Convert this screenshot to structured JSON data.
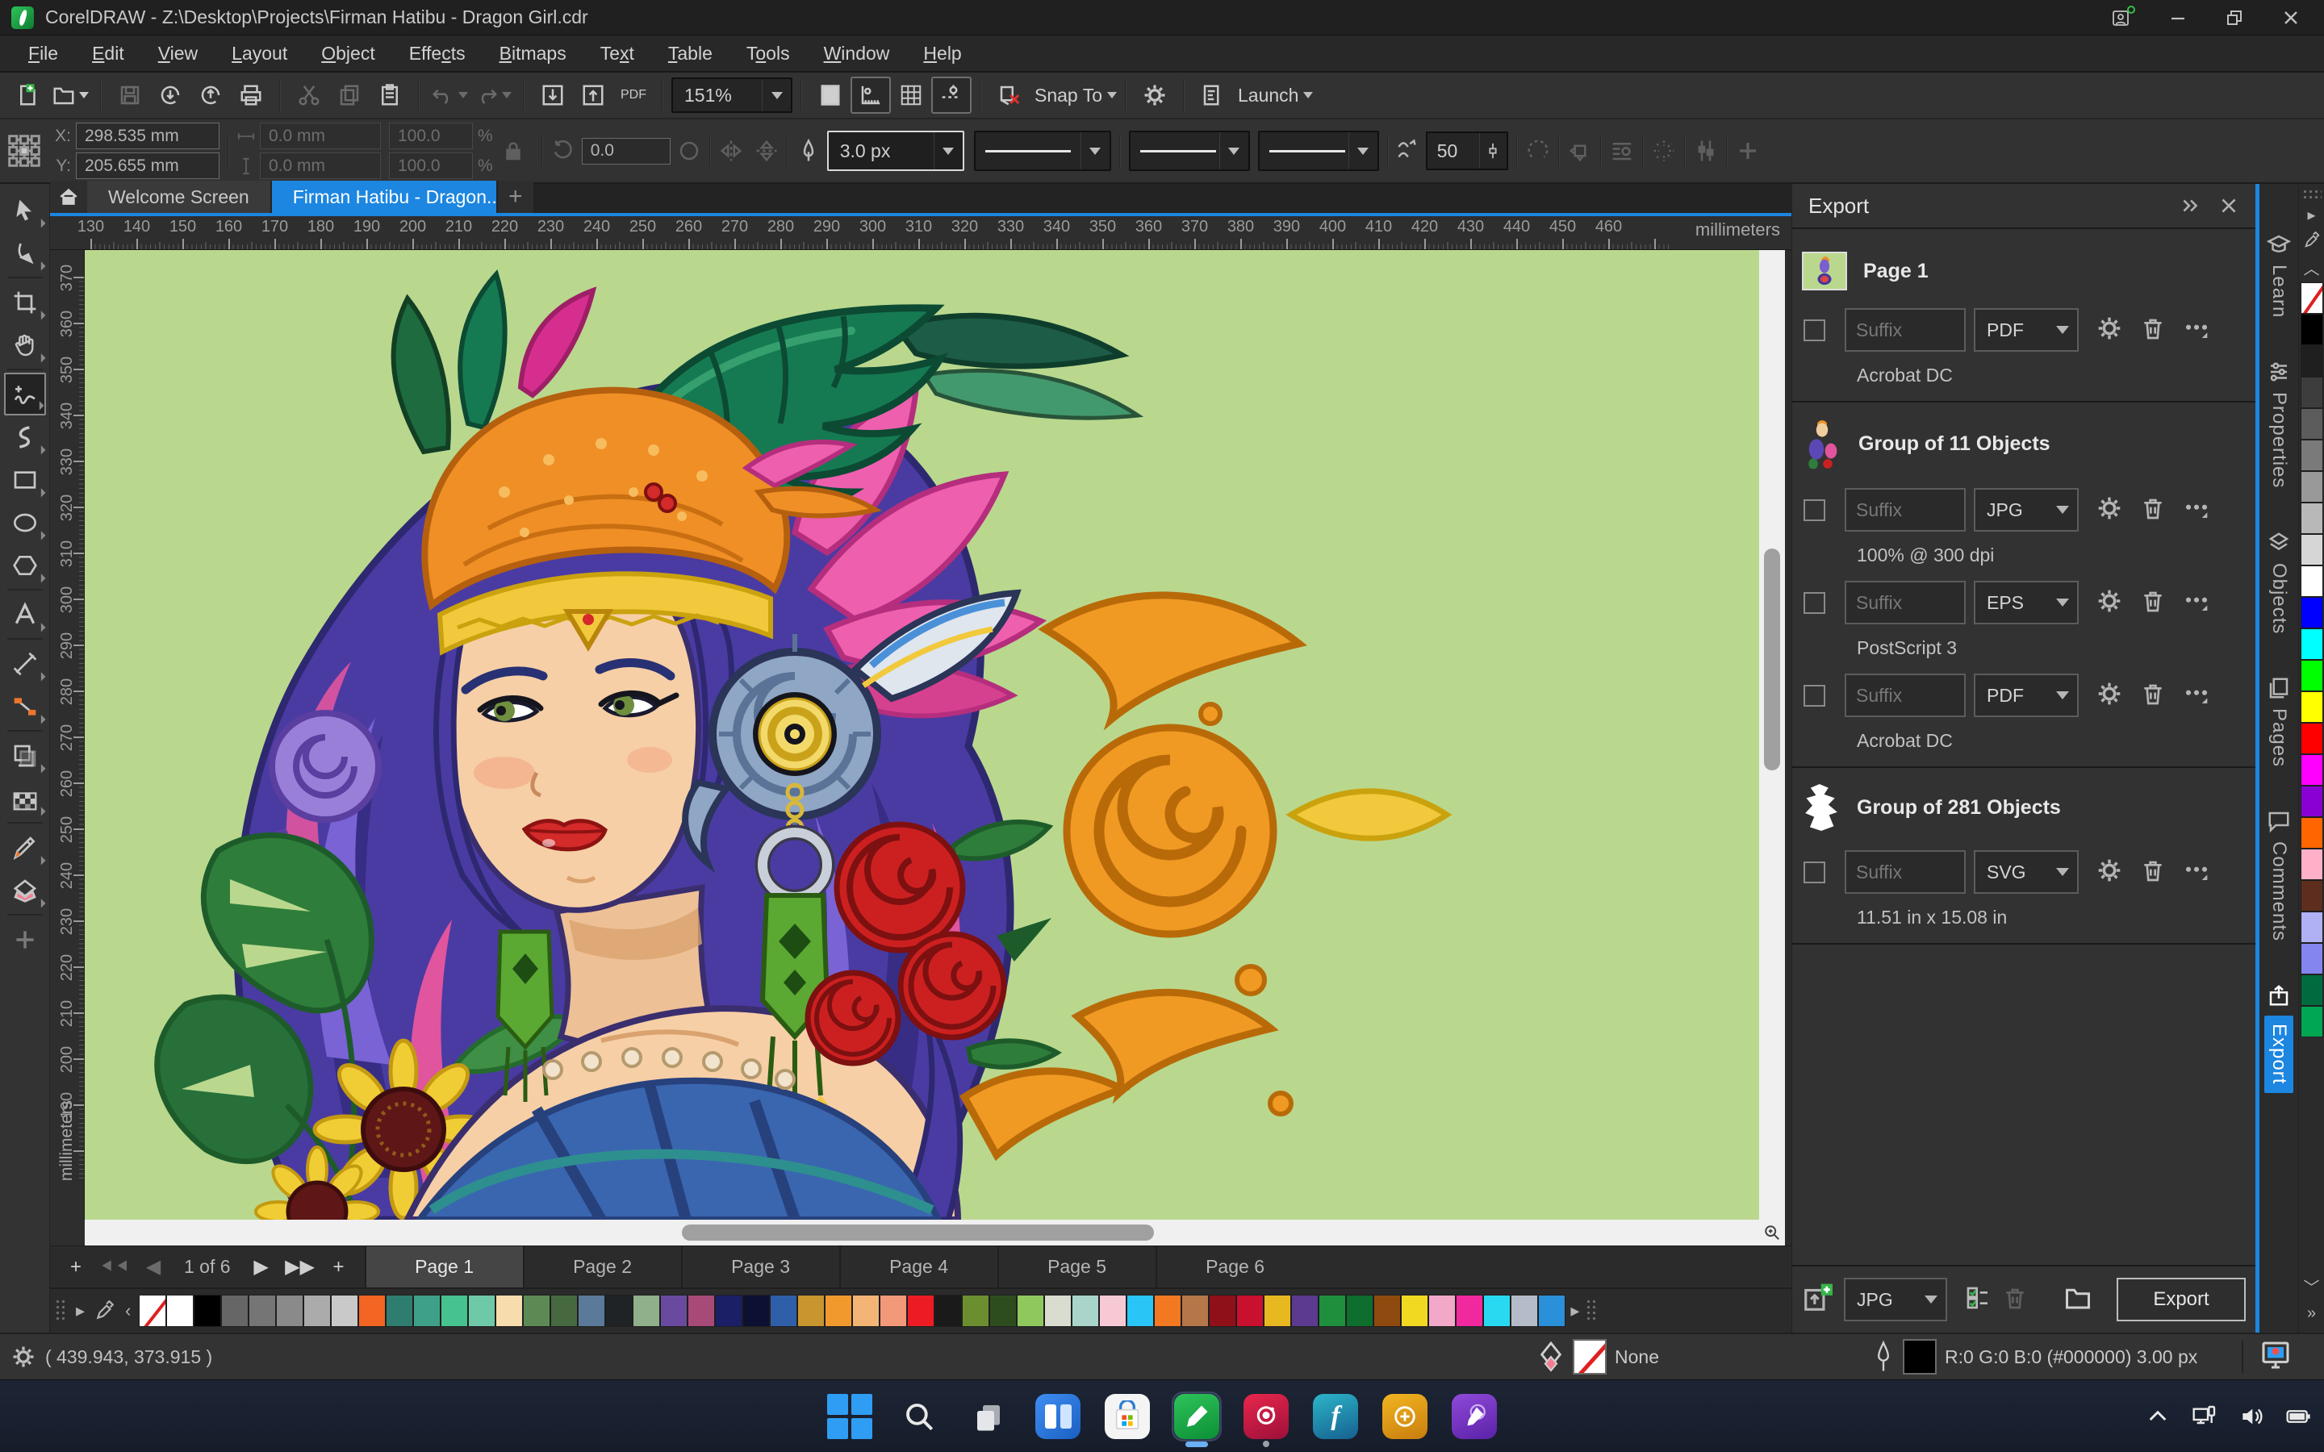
{
  "titlebar": {
    "title": "CorelDRAW - Z:\\Desktop\\Projects\\Firman Hatibu - Dragon Girl.cdr"
  },
  "menu": {
    "items": [
      {
        "label": "File",
        "u": 0
      },
      {
        "label": "Edit",
        "u": 0
      },
      {
        "label": "View",
        "u": 0
      },
      {
        "label": "Layout",
        "u": 0
      },
      {
        "label": "Object",
        "u": 0
      },
      {
        "label": "Effects",
        "u": 4
      },
      {
        "label": "Bitmaps",
        "u": 0
      },
      {
        "label": "Text",
        "u": 2
      },
      {
        "label": "Table",
        "u": 0
      },
      {
        "label": "Tools",
        "u": 1
      },
      {
        "label": "Window",
        "u": 0
      },
      {
        "label": "Help",
        "u": 0
      }
    ]
  },
  "toolbar": {
    "zoom_level": "151%",
    "snap_label": "Snap To",
    "launch_label": "Launch",
    "pdf_label": "PDF"
  },
  "property_bar": {
    "x_label": "X:",
    "y_label": "Y:",
    "x": "298.535 mm",
    "y": "205.655 mm",
    "w": "0.0 mm",
    "h": "0.0 mm",
    "scale_x": "100.0",
    "scale_y": "100.0",
    "pct": "%",
    "angle": "0.0",
    "outline_width": "3.0 px",
    "smoothing": "50"
  },
  "doc_tabs": {
    "tabs": [
      {
        "label": "Welcome Screen",
        "active": false
      },
      {
        "label": "Firman Hatibu - Dragon...",
        "active": true
      }
    ]
  },
  "rulers": {
    "unit": "millimeters",
    "h": [
      130,
      140,
      150,
      160,
      170,
      180,
      190,
      200,
      210,
      220,
      230,
      240,
      250,
      260,
      270,
      280,
      290,
      300,
      310,
      320,
      330,
      340,
      350,
      360,
      370,
      380,
      390,
      400,
      410,
      420,
      430,
      440,
      450,
      460
    ],
    "v": [
      370,
      360,
      350,
      340,
      330,
      320,
      310,
      300,
      290,
      280,
      270,
      260,
      250,
      240,
      230,
      220,
      210,
      200,
      190
    ]
  },
  "toolbox": {
    "tools": [
      "pick",
      "shape",
      "crop",
      "pan",
      "freehand",
      "artistic-media",
      "rectangle",
      "ellipse",
      "polygon",
      "text",
      "dimension",
      "connector",
      "drop-shadow",
      "transparency",
      "color-eyedropper",
      "interactive-fill",
      "add-tool"
    ],
    "active_tool": "freehand"
  },
  "canvas": {
    "background": "#b9d88e"
  },
  "export_panel": {
    "title": "Export",
    "groups": [
      {
        "name": "Page 1",
        "thumb": "page",
        "rows": [
          {
            "placeholder": "Suffix",
            "format": "PDF",
            "detail": "Acrobat DC"
          }
        ]
      },
      {
        "name": "Group of 11 Objects",
        "thumb": "art",
        "rows": [
          {
            "placeholder": "Suffix",
            "format": "JPG",
            "detail": "100% @ 300 dpi"
          },
          {
            "placeholder": "Suffix",
            "format": "EPS",
            "detail": "PostScript 3"
          },
          {
            "placeholder": "Suffix",
            "format": "PDF",
            "detail": "Acrobat DC"
          }
        ]
      },
      {
        "name": "Group of 281 Objects",
        "thumb": "line",
        "rows": [
          {
            "placeholder": "Suffix",
            "format": "SVG",
            "detail": "11.51 in x 15.08 in"
          }
        ]
      }
    ],
    "footer": {
      "format": "JPG",
      "export_label": "Export"
    }
  },
  "docker": {
    "tabs": [
      {
        "label": "Learn",
        "icon": "#di-learn",
        "active": false
      },
      {
        "label": "Properties",
        "icon": "#di-props",
        "active": false
      },
      {
        "label": "Objects",
        "icon": "#di-objects",
        "active": false
      },
      {
        "label": "Pages",
        "icon": "#di-pages",
        "active": false
      },
      {
        "label": "Comments",
        "icon": "#di-comments",
        "active": false
      },
      {
        "label": "Export",
        "icon": "#di-export",
        "active": true
      }
    ]
  },
  "page_bar": {
    "counter": "1 of 6",
    "pages": [
      {
        "label": "Page 1",
        "active": true
      },
      {
        "label": "Page 2",
        "active": false
      },
      {
        "label": "Page 3",
        "active": false
      },
      {
        "label": "Page 4",
        "active": false
      },
      {
        "label": "Page 5",
        "active": false
      },
      {
        "label": "Page 6",
        "active": false
      }
    ]
  },
  "doc_palette": {
    "colors": [
      "none",
      "#ffffff",
      "#000000",
      "#666666",
      "#757575",
      "#8a8a8a",
      "#ababab",
      "#c9c9c9",
      "#f26522",
      "#2e7d6e",
      "#3fa08a",
      "#46c28f",
      "#6ec9a8",
      "#f7dcae",
      "#5d8a54",
      "#46693f",
      "#5b7a99",
      "#1f2326",
      "#8fb08a",
      "#6a4a9e",
      "#a84a78",
      "#1a1f66",
      "#0d1033",
      "#2e5fa8",
      "#c9952e",
      "#f2992e",
      "#f2b575",
      "#f2997a",
      "#ed1c24",
      "#1a1a1a",
      "#6b8f2e",
      "#2e4d1f",
      "#8fc95e",
      "#d9ddd0",
      "#a8d4c9",
      "#f7c9d4",
      "#29c5f7",
      "#f27921",
      "#b5774a",
      "#8f1019",
      "#c9102e",
      "#e8b821",
      "#5b3a8f",
      "#1f8f3e",
      "#0d6e2e",
      "#8f4a0f",
      "#f2d921",
      "#f2a8c9",
      "#f2299e",
      "#29d9f2",
      "#b5bcc9",
      "#2990d9"
    ]
  },
  "right_palette": {
    "colors": [
      "none",
      "#000000",
      "#1f1f1f",
      "#3d3d3d",
      "#5c5c5c",
      "#7a7a7a",
      "#999999",
      "#b8b8b8",
      "#d6d6d6",
      "#ffffff",
      "#0000ff",
      "#00ffff",
      "#00ff00",
      "#ffff00",
      "#ff0000",
      "#ff00ff",
      "#8a00d4",
      "#ff6600",
      "#ffb0c8",
      "#5e2d1e",
      "#b0b0f5",
      "#8585f0",
      "#006b3f",
      "#00a651"
    ]
  },
  "status_bar": {
    "coords": "( 439.943, 373.915 )",
    "fill_label": "None",
    "outline_text": "R:0 G:0 B:0 (#000000)  3.00 px"
  },
  "taskbar": {
    "icons": [
      "start",
      "search",
      "task-view",
      "widgets",
      "microsoft-store",
      "coreldraw",
      "corel-photo-paint",
      "corel-font-manager",
      "coreldraw-app",
      "corel-vector"
    ],
    "active_app": "coreldraw",
    "tray": [
      "hidden-icons",
      "network",
      "volume",
      "battery"
    ]
  },
  "accent": "#1c86e0"
}
